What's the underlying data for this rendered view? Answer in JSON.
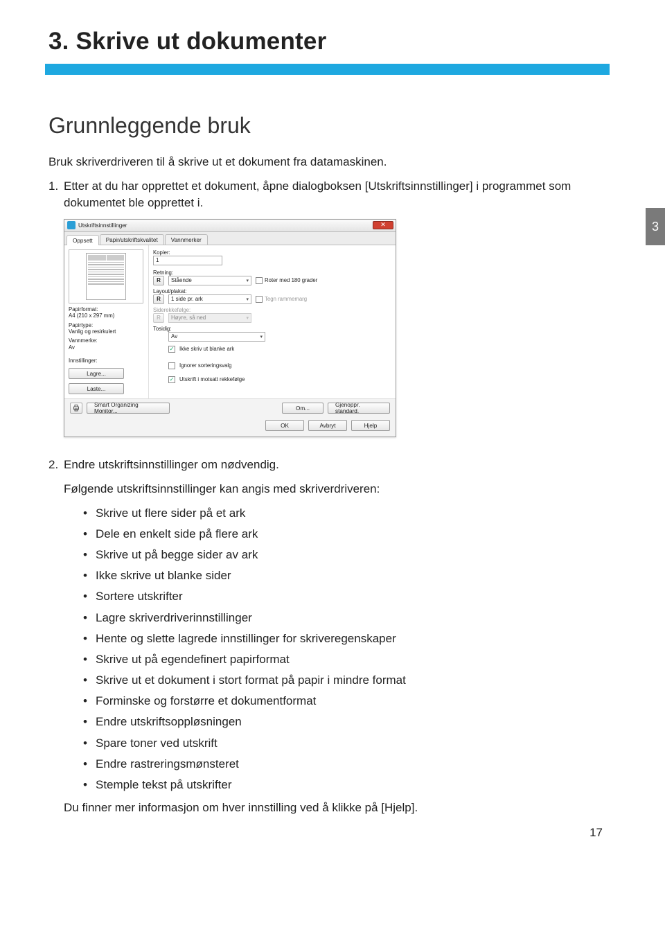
{
  "chapter": {
    "title": "3. Skrive ut dokumenter"
  },
  "side_tab": "3",
  "section": {
    "title": "Grunnleggende bruk"
  },
  "intro": "Bruk skriverdriveren til å skrive ut et dokument fra datamaskinen.",
  "step1_num": "1.",
  "step1": "Etter at du har opprettet et dokument, åpne dialogboksen [Utskriftsinnstillinger] i programmet som dokumentet ble opprettet i.",
  "step2_num": "2.",
  "step2": "Endre utskriftsinnstillinger om nødvendig.",
  "step2_sub": "Følgende utskriftsinnstillinger kan angis med skriverdriveren:",
  "bullets": [
    "Skrive ut flere sider på et ark",
    "Dele en enkelt side på flere ark",
    "Skrive ut på begge sider av ark",
    "Ikke skrive ut blanke sider",
    "Sortere utskrifter",
    "Lagre skriverdriverinnstillinger",
    "Hente og slette lagrede innstillinger for skriveregenskaper",
    "Skrive ut på egendefinert papirformat",
    "Skrive ut et dokument i stort format på papir i mindre format",
    "Forminske og forstørre et dokumentformat",
    "Endre utskriftsoppløsningen",
    "Spare toner ved utskrift",
    "Endre rastreringsmønsteret",
    "Stemple tekst på utskrifter"
  ],
  "closing": "Du finner mer informasjon om hver innstilling ved å klikke på [Hjelp].",
  "page_number": "17",
  "dialog": {
    "title": "Utskriftsinnstillinger",
    "tabs": [
      "Oppsett",
      "Papir/utskriftskvalitet",
      "Vannmerker"
    ],
    "preview": {
      "papirformat_label": "Papirformat:",
      "papirformat_value": "A4 (210 x 297 mm)",
      "papirtype_label": "Papirtype:",
      "papirtype_value": "Vanlig og resirkulert",
      "vannmerke_label": "Vannmerke:",
      "vannmerke_value": "Av",
      "innstillinger_label": "Innstillinger:",
      "lagre_btn": "Lagre...",
      "laste_btn": "Laste..."
    },
    "fields": {
      "kopier_label": "Kopier:",
      "kopier_value": "1",
      "retning_label": "Retning:",
      "retning_value": "Stående",
      "roter_label": "Roter med 180 grader",
      "layout_label": "Layout/plakat:",
      "layout_value": "1 side pr. ark",
      "tegn_label": "Tegn rammemarg",
      "siderekke_label": "Siderekkefølge:",
      "siderekke_value": "Høyre, så ned",
      "tosidig_label": "Tosidig:",
      "tosidig_value": "Av",
      "ikke_blanke_label": "Ikke skriv ut blanke ark",
      "ignorer_label": "Ignorer sorteringsvalg",
      "motsatt_label": "Utskrift i motsatt rekkefølge"
    },
    "footer": {
      "smart_btn": "Smart Organizing Monitor...",
      "om_btn": "Om...",
      "gjenoppr_btn": "Gjenoppr. standard.",
      "ok_btn": "OK",
      "avbryt_btn": "Avbryt",
      "hjelp_btn": "Hjelp"
    }
  }
}
